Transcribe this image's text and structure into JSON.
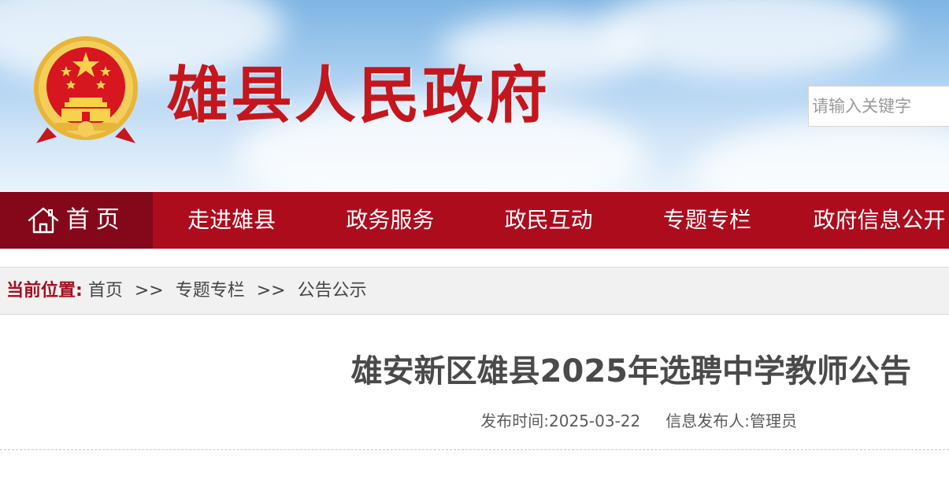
{
  "header": {
    "site_title": "雄县人民政府",
    "emblem_icon": "national-emblem-icon",
    "search_placeholder": "请输入关键字"
  },
  "nav": {
    "home_icon": "home-icon",
    "items": [
      "首页",
      "走进雄县",
      "政务服务",
      "政民互动",
      "专题专栏",
      "政府信息公开"
    ]
  },
  "breadcrumb": {
    "label": "当前位置:",
    "items": [
      "首页",
      "专题专栏",
      "公告公示"
    ],
    "separator": ">>"
  },
  "article": {
    "title": "雄安新区雄县2025年选聘中学教师公告",
    "publish_label": "发布时间:",
    "publish_date": "2025-03-22",
    "publisher_label": "信息发布人:",
    "publisher": "管理员"
  },
  "colors": {
    "brand_red": "#ad0c1d",
    "home_tab_red": "#85081a",
    "title_red": "#c5161d"
  }
}
